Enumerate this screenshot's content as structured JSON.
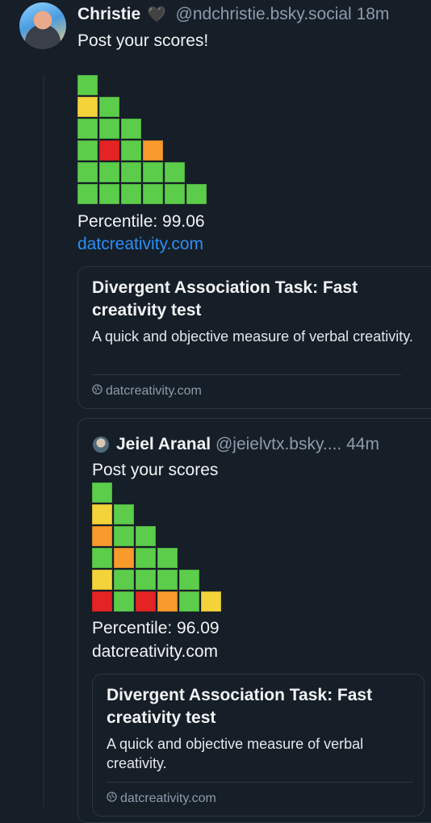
{
  "post": {
    "author": "Christie",
    "heart": "🖤",
    "handle": "@ndchristie.bsky.social",
    "time": "18m",
    "text": "Post your scores!",
    "grid": [
      [
        "g"
      ],
      [
        "y",
        "g"
      ],
      [
        "g",
        "g",
        "g"
      ],
      [
        "g",
        "r",
        "g",
        "o"
      ],
      [
        "g",
        "g",
        "g",
        "g",
        "g"
      ],
      [
        "g",
        "g",
        "g",
        "g",
        "g",
        "g"
      ]
    ],
    "percentile": "Percentile: 99.06",
    "link": "datcreativity.com",
    "card": {
      "title": "Divergent Association Task: Fast creativity test",
      "description": "A quick and objective measure of verbal creativity.",
      "domain": "datcreativity.com"
    }
  },
  "quote": {
    "author": "Jeiel Aranal",
    "handle": "@jeielvtx.bsky....",
    "time": "44m",
    "text": "Post your scores",
    "grid": [
      [
        "g"
      ],
      [
        "y",
        "g"
      ],
      [
        "o",
        "g",
        "g"
      ],
      [
        "g",
        "o",
        "g",
        "g"
      ],
      [
        "y",
        "g",
        "g",
        "g",
        "g"
      ],
      [
        "r",
        "g",
        "r",
        "o",
        "g",
        "y"
      ]
    ],
    "percentile": "Percentile: 96.09",
    "link": "datcreativity.com",
    "card": {
      "title": "Divergent Association Task: Fast creativity test",
      "description": "A quick and objective measure of verbal creativity.",
      "domain": "datcreativity.com"
    }
  },
  "colors": {
    "g": "#5ccd4b",
    "y": "#f4d23a",
    "o": "#f89a2c",
    "r": "#e42424",
    "link": "#2a8ff7",
    "background": "#161e27"
  },
  "icons": {
    "avatar": "user-avatar",
    "globe": "globe-icon"
  }
}
